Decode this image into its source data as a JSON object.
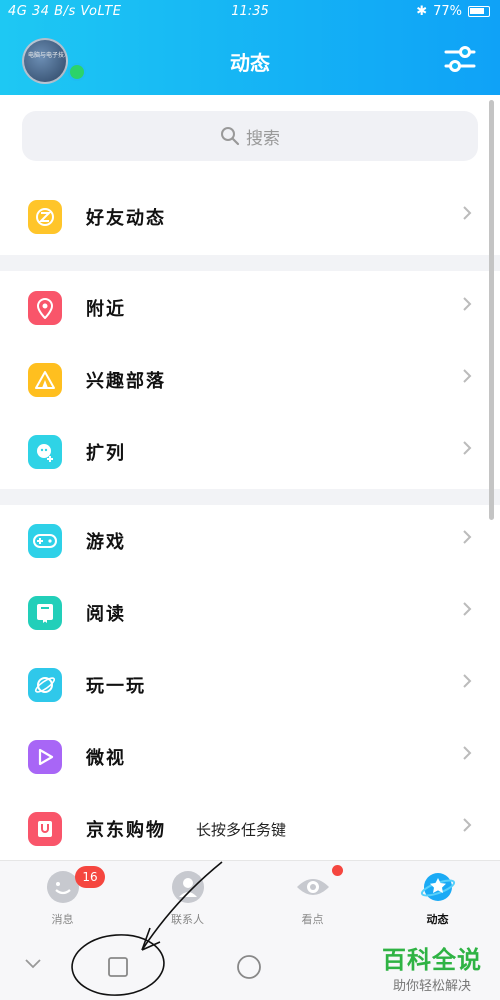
{
  "status_bar": {
    "left": "4G 34 B/s VoLTE",
    "time": "11:35",
    "battery": "77%"
  },
  "header": {
    "title": "动态",
    "avatar_caption": "电脑与电子技术"
  },
  "search": {
    "placeholder": "搜索"
  },
  "sections": [
    {
      "items": [
        {
          "label": "好友动态",
          "icon": "star-z-icon",
          "color": "#ffc52a"
        }
      ]
    },
    {
      "items": [
        {
          "label": "附近",
          "icon": "location-pin-icon",
          "color": "#f9556a"
        },
        {
          "label": "兴趣部落",
          "icon": "tent-icon",
          "color": "#ffbf1f"
        },
        {
          "label": "扩列",
          "icon": "face-plus-icon",
          "color": "#2fd3e6"
        }
      ]
    },
    {
      "items": [
        {
          "label": "游戏",
          "icon": "gamepad-icon",
          "color": "#2ed1e8"
        },
        {
          "label": "阅读",
          "icon": "book-icon",
          "color": "#22cfb9"
        },
        {
          "label": "玩一玩",
          "icon": "planet-icon",
          "color": "#2fc8ea"
        },
        {
          "label": "微视",
          "icon": "play-icon",
          "color": "#a866f6"
        },
        {
          "label": "京东购物",
          "icon": "bag-icon",
          "color": "#f9556a",
          "extra": "长按多任务键"
        }
      ]
    }
  ],
  "tabs": [
    {
      "label": "消息",
      "badge": "16",
      "icon": "smile-icon"
    },
    {
      "label": "联系人",
      "icon": "person-icon"
    },
    {
      "label": "看点",
      "icon": "eye-icon",
      "dot": true
    },
    {
      "label": "动态",
      "icon": "star-planet-icon",
      "active": true
    }
  ],
  "watermark": {
    "main": "百科全说",
    "sub": "助你轻松解决"
  },
  "colors": {
    "header": "#14b1f5",
    "badge": "#f5463f",
    "watermark": "#2fb344"
  }
}
